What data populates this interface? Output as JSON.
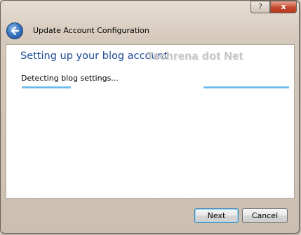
{
  "window": {
    "title": "Update Account Configuration",
    "help_label": "?",
    "close_label": "x"
  },
  "main": {
    "heading": "Setting up your blog account",
    "watermark": "Techrena dot Net",
    "status": "Detecting blog settings..."
  },
  "progress": {
    "state": "indeterminate"
  },
  "footer": {
    "next_label": "Next",
    "cancel_label": "Cancel"
  },
  "icons": {
    "back": "back-arrow-icon"
  },
  "colors": {
    "heading": "#1c4b93",
    "progress": "#4aa6e4",
    "close_button": "#c2482e"
  }
}
